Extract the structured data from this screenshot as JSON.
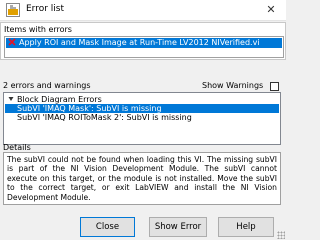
{
  "window": {
    "title": "Error list",
    "close_glyph": "✕"
  },
  "items_with_errors": {
    "heading": "Items with errors",
    "items": [
      "Apply ROI and Mask Image at Run-Time LV2012 NIVerified.vi"
    ]
  },
  "errors_and_warnings": {
    "heading": "2 errors and warnings",
    "show_warnings_label": "Show Warnings",
    "show_warnings_checked": false,
    "group_label": "Block Diagram Errors",
    "errors": [
      "SubVI 'IMAQ Mask': SubVI is missing",
      "SubVI 'IMAQ ROIToMask 2': SubVI is missing"
    ]
  },
  "details": {
    "heading": "Details",
    "text": "The subVI could not be found when loading this VI.  The missing subVI is part of the NI Vision Development Module.  The subVI cannot execute on this target, or the module is not installed.  Move the subVI to the correct target, or exit LabVIEW and install the NI Vision Development Module."
  },
  "buttons": {
    "close": "Close",
    "show_error": "Show Error",
    "help": "Help"
  },
  "colors": {
    "selection": "#0078d7",
    "error_icon": "#e81123"
  }
}
